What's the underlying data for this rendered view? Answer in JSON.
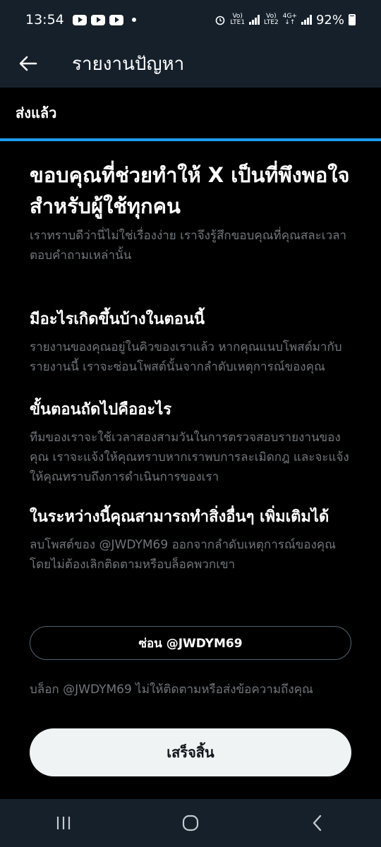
{
  "status": {
    "time": "13:54",
    "lte1": "LTE1",
    "lte2": "LTE2",
    "net": "4G+",
    "battery": "92%"
  },
  "header": {
    "title": "รายงานปัญหา"
  },
  "sent_label": "ส่งแล้ว",
  "progress": 1.0,
  "headline": "ขอบคุณที่ช่วยทำให้ X เป็นที่พึงพอใจสำหรับผู้ใช้ทุกคน",
  "subhead": "เราทราบดีว่านี่ไม่ใช่เรื่องง่าย เราจึงรู้สึกขอบคุณที่คุณสละเวลาตอบคำถามเหล่านั้น",
  "sections": [
    {
      "title": "มีอะไรเกิดขึ้นบ้างในตอนนี้",
      "body": "รายงานของคุณอยู่ในคิวของเราแล้ว หากคุณแนบโพสต์มากับรายงานนี้ เราจะซ่อนโพสต์นั้นจากลำดับเหตุการณ์ของคุณ"
    },
    {
      "title": "ขั้นตอนถัดไปคืออะไร",
      "body": "ทีมของเราจะใช้เวลาสองสามวันในการตรวจสอบรายงานของคุณ เราจะแจ้งให้คุณทราบหากเราพบการละเมิดกฎ และจะแจ้งให้คุณทราบถึงการดำเนินการของเรา"
    },
    {
      "title": "ในระหว่างนี้คุณสามารถทำสิ่งอื่นๆ เพิ่มเติมได้",
      "body": "ลบโพสต์ของ @JWDYM69 ออกจากลำดับเหตุการณ์ของคุณ โดยไม่ต้องเลิกติดตามหรือบล็อคพวกเขา"
    }
  ],
  "mute_button": "ซ่อน @JWDYM69",
  "block_text": "บล็อก @JWDYM69 ไม่ให้ติดตามหรือส่งข้อความถึงคุณ",
  "done_button": "เสร็จสิ้น"
}
